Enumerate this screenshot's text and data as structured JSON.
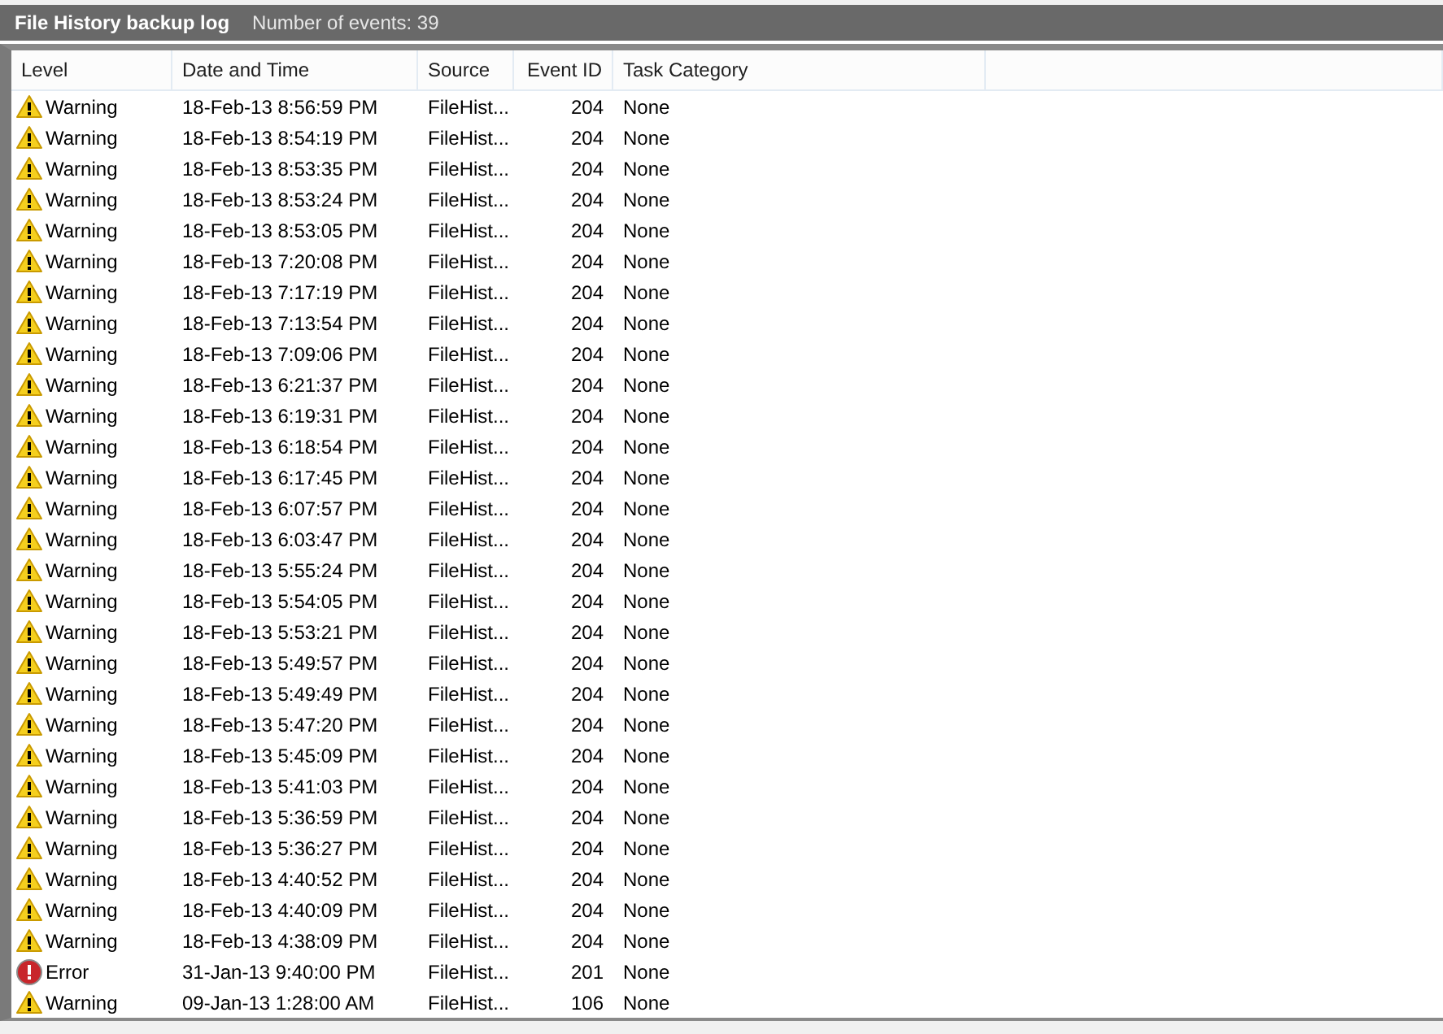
{
  "log_bar": {
    "title": "File History backup log",
    "event_count": "Number of events: 39"
  },
  "table": {
    "columns": [
      "Level",
      "Date and Time",
      "Source",
      "Event ID",
      "Task Category"
    ],
    "rows": [
      {
        "kind": "warning",
        "level": "Warning",
        "date_time": "18-Feb-13 8:56:59 PM",
        "source": "FileHist...",
        "event_id": "204",
        "task_category": "None"
      },
      {
        "kind": "warning",
        "level": "Warning",
        "date_time": "18-Feb-13 8:54:19 PM",
        "source": "FileHist...",
        "event_id": "204",
        "task_category": "None"
      },
      {
        "kind": "warning",
        "level": "Warning",
        "date_time": "18-Feb-13 8:53:35 PM",
        "source": "FileHist...",
        "event_id": "204",
        "task_category": "None"
      },
      {
        "kind": "warning",
        "level": "Warning",
        "date_time": "18-Feb-13 8:53:24 PM",
        "source": "FileHist...",
        "event_id": "204",
        "task_category": "None"
      },
      {
        "kind": "warning",
        "level": "Warning",
        "date_time": "18-Feb-13 8:53:05 PM",
        "source": "FileHist...",
        "event_id": "204",
        "task_category": "None"
      },
      {
        "kind": "warning",
        "level": "Warning",
        "date_time": "18-Feb-13 7:20:08 PM",
        "source": "FileHist...",
        "event_id": "204",
        "task_category": "None"
      },
      {
        "kind": "warning",
        "level": "Warning",
        "date_time": "18-Feb-13 7:17:19 PM",
        "source": "FileHist...",
        "event_id": "204",
        "task_category": "None"
      },
      {
        "kind": "warning",
        "level": "Warning",
        "date_time": "18-Feb-13 7:13:54 PM",
        "source": "FileHist...",
        "event_id": "204",
        "task_category": "None"
      },
      {
        "kind": "warning",
        "level": "Warning",
        "date_time": "18-Feb-13 7:09:06 PM",
        "source": "FileHist...",
        "event_id": "204",
        "task_category": "None"
      },
      {
        "kind": "warning",
        "level": "Warning",
        "date_time": "18-Feb-13 6:21:37 PM",
        "source": "FileHist...",
        "event_id": "204",
        "task_category": "None"
      },
      {
        "kind": "warning",
        "level": "Warning",
        "date_time": "18-Feb-13 6:19:31 PM",
        "source": "FileHist...",
        "event_id": "204",
        "task_category": "None"
      },
      {
        "kind": "warning",
        "level": "Warning",
        "date_time": "18-Feb-13 6:18:54 PM",
        "source": "FileHist...",
        "event_id": "204",
        "task_category": "None"
      },
      {
        "kind": "warning",
        "level": "Warning",
        "date_time": "18-Feb-13 6:17:45 PM",
        "source": "FileHist...",
        "event_id": "204",
        "task_category": "None"
      },
      {
        "kind": "warning",
        "level": "Warning",
        "date_time": "18-Feb-13 6:07:57 PM",
        "source": "FileHist...",
        "event_id": "204",
        "task_category": "None"
      },
      {
        "kind": "warning",
        "level": "Warning",
        "date_time": "18-Feb-13 6:03:47 PM",
        "source": "FileHist...",
        "event_id": "204",
        "task_category": "None"
      },
      {
        "kind": "warning",
        "level": "Warning",
        "date_time": "18-Feb-13 5:55:24 PM",
        "source": "FileHist...",
        "event_id": "204",
        "task_category": "None"
      },
      {
        "kind": "warning",
        "level": "Warning",
        "date_time": "18-Feb-13 5:54:05 PM",
        "source": "FileHist...",
        "event_id": "204",
        "task_category": "None"
      },
      {
        "kind": "warning",
        "level": "Warning",
        "date_time": "18-Feb-13 5:53:21 PM",
        "source": "FileHist...",
        "event_id": "204",
        "task_category": "None"
      },
      {
        "kind": "warning",
        "level": "Warning",
        "date_time": "18-Feb-13 5:49:57 PM",
        "source": "FileHist...",
        "event_id": "204",
        "task_category": "None"
      },
      {
        "kind": "warning",
        "level": "Warning",
        "date_time": "18-Feb-13 5:49:49 PM",
        "source": "FileHist...",
        "event_id": "204",
        "task_category": "None"
      },
      {
        "kind": "warning",
        "level": "Warning",
        "date_time": "18-Feb-13 5:47:20 PM",
        "source": "FileHist...",
        "event_id": "204",
        "task_category": "None"
      },
      {
        "kind": "warning",
        "level": "Warning",
        "date_time": "18-Feb-13 5:45:09 PM",
        "source": "FileHist...",
        "event_id": "204",
        "task_category": "None"
      },
      {
        "kind": "warning",
        "level": "Warning",
        "date_time": "18-Feb-13 5:41:03 PM",
        "source": "FileHist...",
        "event_id": "204",
        "task_category": "None"
      },
      {
        "kind": "warning",
        "level": "Warning",
        "date_time": "18-Feb-13 5:36:59 PM",
        "source": "FileHist...",
        "event_id": "204",
        "task_category": "None"
      },
      {
        "kind": "warning",
        "level": "Warning",
        "date_time": "18-Feb-13 5:36:27 PM",
        "source": "FileHist...",
        "event_id": "204",
        "task_category": "None"
      },
      {
        "kind": "warning",
        "level": "Warning",
        "date_time": "18-Feb-13 4:40:52 PM",
        "source": "FileHist...",
        "event_id": "204",
        "task_category": "None"
      },
      {
        "kind": "warning",
        "level": "Warning",
        "date_time": "18-Feb-13 4:40:09 PM",
        "source": "FileHist...",
        "event_id": "204",
        "task_category": "None"
      },
      {
        "kind": "warning",
        "level": "Warning",
        "date_time": "18-Feb-13 4:38:09 PM",
        "source": "FileHist...",
        "event_id": "204",
        "task_category": "None"
      },
      {
        "kind": "error",
        "level": "Error",
        "date_time": "31-Jan-13 9:40:00 PM",
        "source": "FileHist...",
        "event_id": "201",
        "task_category": "None"
      },
      {
        "kind": "warning",
        "level": "Warning",
        "date_time": "09-Jan-13 1:28:00 AM",
        "source": "FileHist...",
        "event_id": "106",
        "task_category": "None"
      }
    ]
  }
}
